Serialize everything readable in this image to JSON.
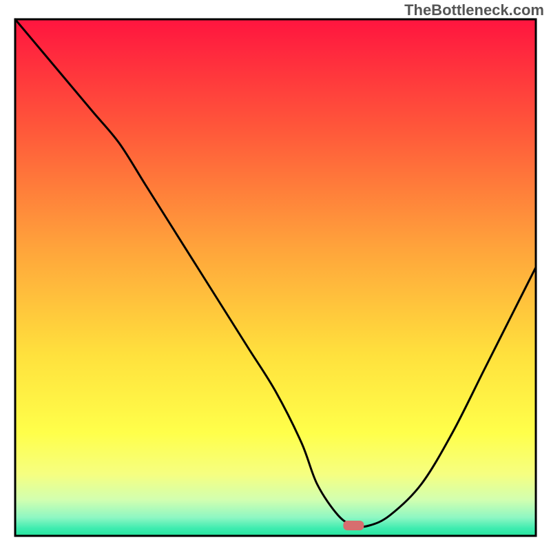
{
  "watermark": "TheBottleneck.com",
  "chart_data": {
    "type": "line",
    "title": "",
    "xlabel": "",
    "ylabel": "",
    "xlim": [
      0,
      100
    ],
    "ylim": [
      0,
      100
    ],
    "x": [
      0,
      5,
      10,
      15,
      20,
      25,
      30,
      35,
      40,
      45,
      50,
      55,
      58,
      62,
      65,
      68,
      72,
      78,
      84,
      90,
      95,
      100
    ],
    "y": [
      100,
      94,
      88,
      82,
      76,
      68,
      60,
      52,
      44,
      36,
      28,
      18,
      10,
      4,
      2,
      2,
      4,
      10,
      20,
      32,
      42,
      52
    ],
    "marker": {
      "x": 65,
      "y": 2
    },
    "gradient_colors": [
      {
        "offset": 0.0,
        "color": "#FF153F"
      },
      {
        "offset": 0.22,
        "color": "#FF5A3A"
      },
      {
        "offset": 0.45,
        "color": "#FFA63B"
      },
      {
        "offset": 0.65,
        "color": "#FFE13D"
      },
      {
        "offset": 0.8,
        "color": "#FFFF4A"
      },
      {
        "offset": 0.88,
        "color": "#F6FF80"
      },
      {
        "offset": 0.93,
        "color": "#D2FFB0"
      },
      {
        "offset": 0.965,
        "color": "#8DF7C3"
      },
      {
        "offset": 0.985,
        "color": "#40ECB0"
      },
      {
        "offset": 1.0,
        "color": "#26E59E"
      }
    ],
    "marker_color": "#D76E6F",
    "frame_color": "#000000",
    "line_color": "#000000"
  }
}
